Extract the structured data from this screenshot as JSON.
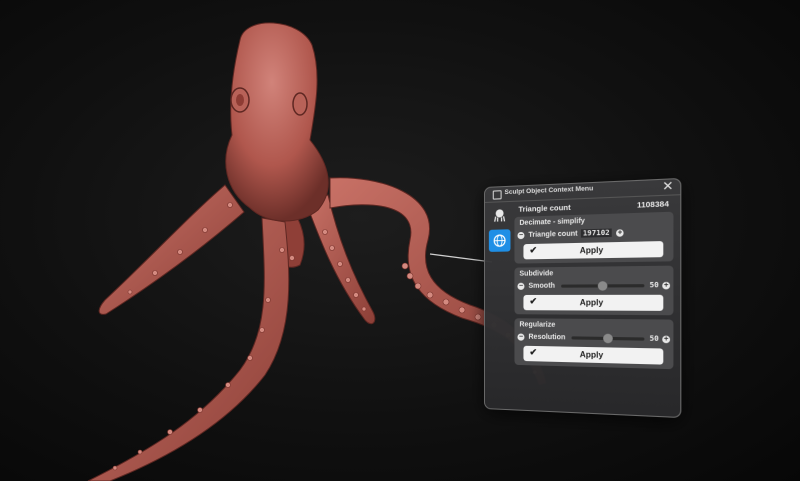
{
  "panel": {
    "title": "Sculpt Object Context Menu",
    "close_icon": "close-icon",
    "triangle_count": {
      "label": "Triangle count",
      "value": "1108384"
    },
    "decimate": {
      "title": "Decimate - simplify",
      "field_label": "Triangle count",
      "field_value": "197102",
      "apply_label": "Apply"
    },
    "subdivide": {
      "title": "Subdivide",
      "label": "Smooth",
      "value": "50",
      "level": 0.5,
      "apply_label": "Apply"
    },
    "regularize": {
      "title": "Regularize",
      "label": "Resolution",
      "value": "50",
      "level": 0.5,
      "apply_label": "Apply"
    }
  },
  "colors": {
    "accent": "#1f8fe6",
    "octopus": "#b55a4f",
    "background": "#0b0b0b"
  }
}
